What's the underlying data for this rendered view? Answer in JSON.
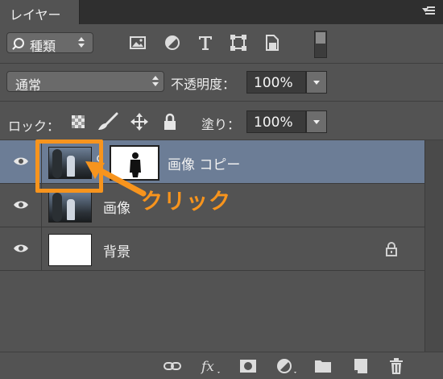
{
  "panel": {
    "tab_title": "レイヤー"
  },
  "filter": {
    "kind_label": "種類",
    "icons": [
      "image-filter-icon",
      "adjustment-filter-icon",
      "type-filter-icon",
      "shape-filter-icon",
      "smart-object-filter-icon"
    ]
  },
  "blend": {
    "mode": "通常",
    "opacity_label": "不透明度：",
    "opacity_value": "100%"
  },
  "lock": {
    "label": "ロック：",
    "fill_label": "塗り：",
    "fill_value": "100%"
  },
  "layers": [
    {
      "name": "画像 コピー",
      "selected": true,
      "has_mask": true
    },
    {
      "name": "画像",
      "selected": false,
      "has_mask": false
    },
    {
      "name": "背景",
      "selected": false,
      "has_mask": false,
      "locked": true
    }
  ],
  "annotation": {
    "text": "クリック",
    "color": "#f7941d"
  },
  "colors": {
    "panel_bg": "#535353",
    "selected_row": "#6c7d96",
    "accent": "#f7941d"
  },
  "bottom_icons": [
    "link-layers-icon",
    "fx-icon",
    "add-mask-icon",
    "adjustment-layer-icon",
    "group-folder-icon",
    "new-layer-icon",
    "trash-icon"
  ]
}
